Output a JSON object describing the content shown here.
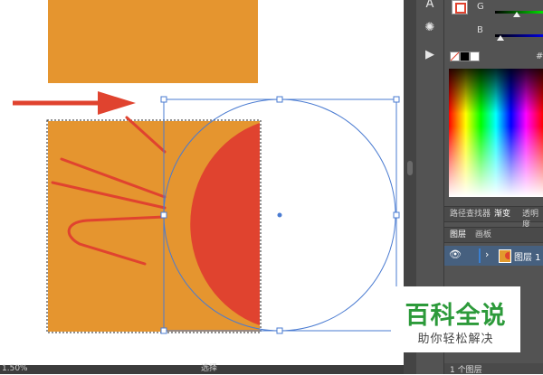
{
  "panel": {
    "sliders": [
      {
        "label": "G",
        "value": 0.4,
        "track": "linear-gradient(to right,#000,#0f0)"
      },
      {
        "label": "B",
        "value": 0.1,
        "track": "linear-gradient(to right,#000,#00f)"
      }
    ],
    "hex_symbol": "#",
    "tabs_top": [
      "路径查找器",
      "渐变",
      "透明度"
    ],
    "tabs_layers": [
      "图层",
      "画板"
    ],
    "layer_name": "图层 1",
    "footer_text": "1 个图层"
  },
  "statusbar": {
    "zoom": "1.50%",
    "mode": "选择"
  },
  "watermark": {
    "title": "百科全说",
    "subtitle": "助你轻松解决"
  },
  "colors": {
    "orange": "#e5952f",
    "red": "#e0432f",
    "selection": "#4a7bd1",
    "arrow": "#e0432f"
  }
}
